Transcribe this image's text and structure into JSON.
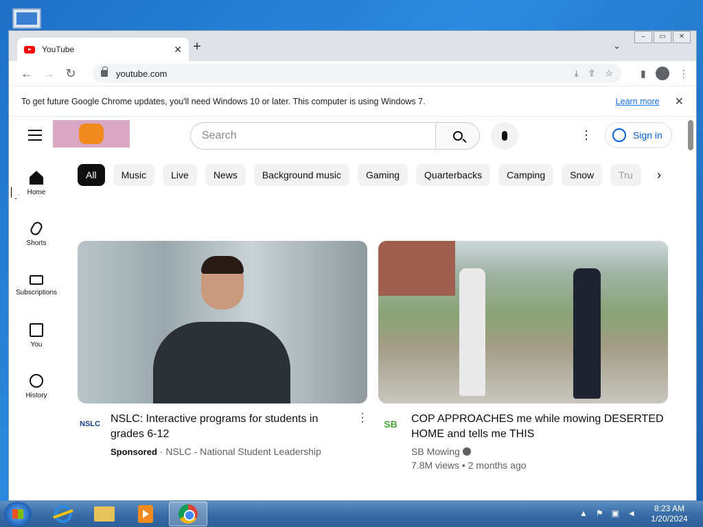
{
  "browser": {
    "tab_title": "YouTube",
    "new_tab_symbol": "+",
    "url": "youtube.com",
    "infobar_text": "To get future Google Chrome updates, you'll need Windows 10 or later. This computer is using Windows 7.",
    "infobar_link": "Learn more"
  },
  "youtube": {
    "search_placeholder": "Search",
    "sign_in": "Sign in",
    "sidenav": [
      "Home",
      "Shorts",
      "Subscriptions",
      "You",
      "History"
    ],
    "chips": [
      "All",
      "Music",
      "Live",
      "News",
      "Background music",
      "Gaming",
      "Quarterbacks",
      "Camping",
      "Snow",
      "Tru"
    ],
    "videos": [
      {
        "title": "NSLC: Interactive programs for students in grades 6-12",
        "sponsored": "Sponsored",
        "channel": "NSLC - National Student Leadership",
        "avatar": "NSLC"
      },
      {
        "title": "COP APPROACHES me while mowing DESERTED HOME and tells me THIS",
        "channel": "SB Mowing",
        "stats": "7.8M views • 2 months ago",
        "avatar": "SB"
      }
    ]
  },
  "taskbar": {
    "time": "8:23 AM",
    "date": "1/20/2024"
  },
  "colors": {
    "youtube_red": "#ff0000",
    "link_blue": "#1a73e8",
    "signin_blue": "#065fd4",
    "taskbar": "#3a6ea8"
  }
}
